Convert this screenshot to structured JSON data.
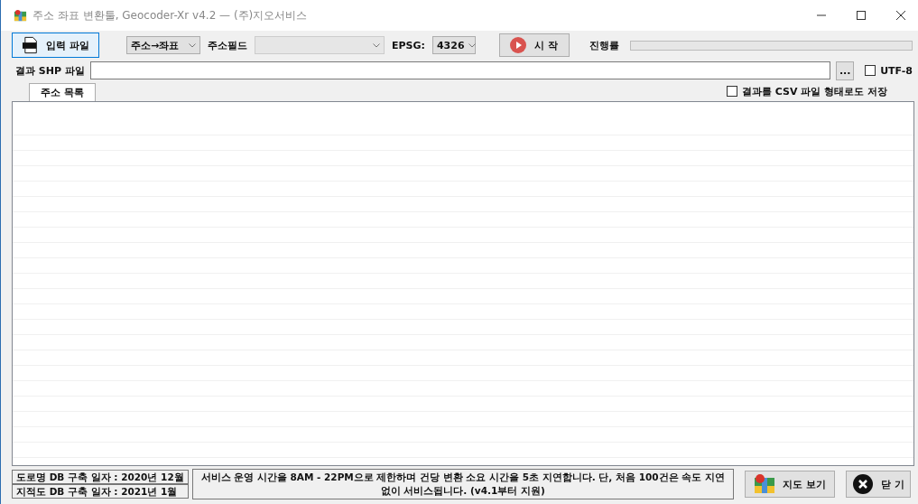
{
  "window": {
    "title": "주소 좌표 변환툴, Geocoder-Xr v4.2 — (주)지오서비스"
  },
  "toolbar": {
    "input_button": "입력 파일",
    "mode_select": {
      "value": "주소→좌표"
    },
    "field_label": "주소필드",
    "epsg_label": "EPSG:",
    "epsg_select": {
      "value": "4326"
    },
    "start_button": "시 작",
    "progress_label": "진행률",
    "progress": {
      "level": 0
    }
  },
  "output": {
    "label": "결과 SHP 파일",
    "browse_button": "...",
    "utf8": {
      "label": "UTF-8",
      "checked": false
    },
    "csv": {
      "label": "결과를 CSV 파일 형태로도 저장",
      "checked": false
    }
  },
  "tabs": [
    {
      "label": "주소 목록",
      "selected": true
    }
  ],
  "footer": {
    "db_dates": [
      "도로명 DB 구축 일자 : 2020년 12월",
      "지적도 DB 구축 일자 : 2021년 1월"
    ],
    "notice": "서비스 운영 시간을 8AM - 22PM으로 제한하며 건당 변환 소요 시간을 5초 지연합니다. 단, 처음 100건은 속도 지연 없이 서비스됩니다. (v4.1부터 지원)",
    "map_button": "지도 보기",
    "close_button": "닫 기"
  }
}
